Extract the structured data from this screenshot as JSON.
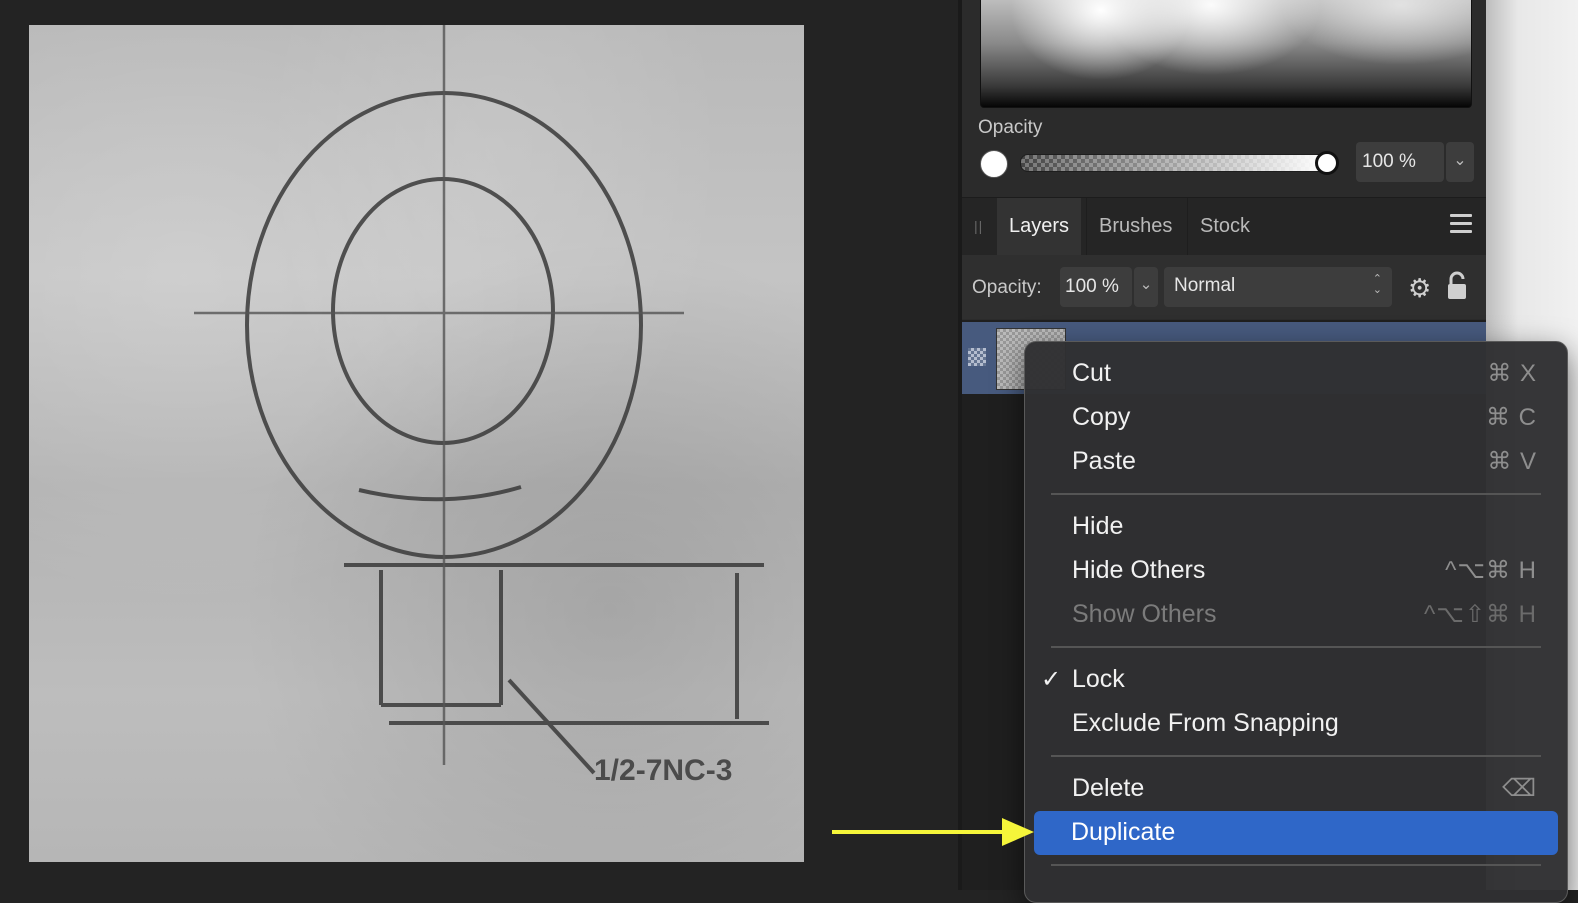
{
  "colour_panel": {
    "opacity_title": "Opacity",
    "opacity_value": "100 %"
  },
  "tabs": [
    {
      "label": "Layers",
      "active": true
    },
    {
      "label": "Brushes",
      "active": false
    },
    {
      "label": "Stock",
      "active": false
    }
  ],
  "layer_controls": {
    "opacity_label": "Opacity:",
    "opacity_value": "100 %",
    "blend_mode": "Normal"
  },
  "document": {
    "drawing_label": "1/2-7NC-3"
  },
  "context_menu": {
    "items": [
      {
        "label": "Cut",
        "shortcut": "⌘ X",
        "enabled": true
      },
      {
        "label": "Copy",
        "shortcut": "⌘ C",
        "enabled": true
      },
      {
        "label": "Paste",
        "shortcut": "⌘ V",
        "enabled": true
      },
      {
        "label": "Hide",
        "shortcut": "",
        "enabled": true
      },
      {
        "label": "Hide Others",
        "shortcut": "^⌥⌘ H",
        "enabled": true
      },
      {
        "label": "Show Others",
        "shortcut": "^⌥⇧⌘ H",
        "enabled": false
      },
      {
        "label": "Lock",
        "shortcut": "",
        "enabled": true,
        "checked": true
      },
      {
        "label": "Exclude From Snapping",
        "shortcut": "",
        "enabled": true
      },
      {
        "label": "Delete",
        "shortcut": "⌫",
        "enabled": true
      },
      {
        "label": "Duplicate",
        "shortcut": "",
        "enabled": true,
        "selected": true
      }
    ]
  },
  "colors": {
    "selection_blue": "#2f67c8",
    "layer_row_blue": "#475a7e",
    "annotation_arrow": "#f5f53a"
  }
}
